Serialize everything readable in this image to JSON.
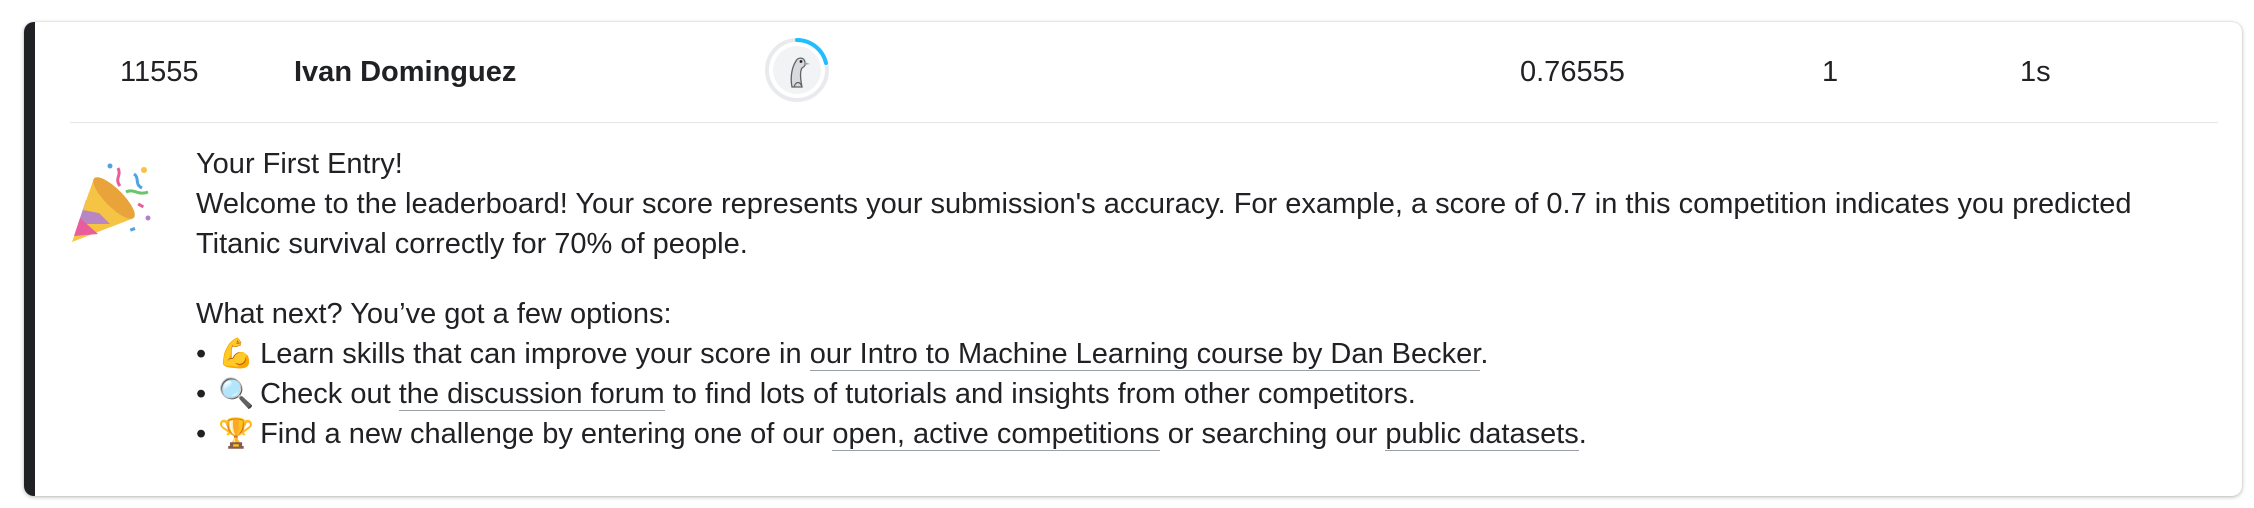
{
  "entry": {
    "rank": "11555",
    "team_name": "Ivan Dominguez",
    "score": "0.76555",
    "entries": "1",
    "last": "1s",
    "avatar_icon": "kaggle-goose-avatar"
  },
  "notice": {
    "icon": "party-popper-icon",
    "title": "Your First Entry!",
    "body": "Welcome to the leaderboard! Your score represents your submission's accuracy. For example, a score of 0.7 in this competition indicates you predicted Titanic survival correctly for 70% of people.",
    "next_heading": "What next? You’ve got a few options:",
    "bullets": [
      {
        "emoji": "💪",
        "pre": "Learn skills that can improve your score in ",
        "link": "our Intro to Machine Learning course by Dan Becker",
        "post": "."
      },
      {
        "emoji": "🔍",
        "pre": "Check out ",
        "link": "the discussion forum",
        "post": " to find lots of tutorials and insights from other competitors."
      },
      {
        "emoji": "🏆",
        "pre": "Find a new challenge by entering one of our ",
        "link": "open, active competitions",
        "mid": " or searching our ",
        "link2": "public datasets",
        "post": "."
      }
    ]
  },
  "colors": {
    "accent_bar": "#202124",
    "progress_ring": "#20beff"
  }
}
